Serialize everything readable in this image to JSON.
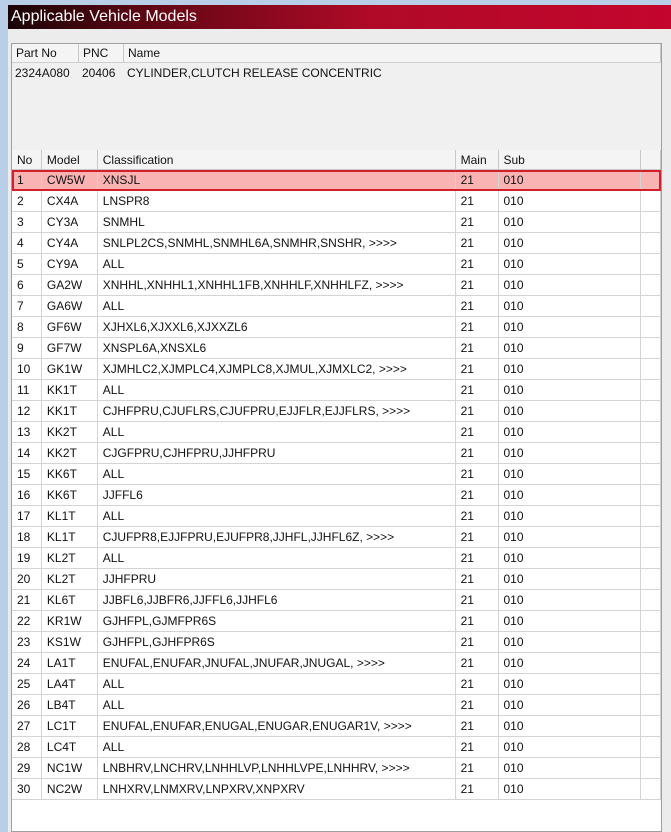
{
  "title": "Applicable Vehicle Models",
  "part": {
    "headers": [
      "Part No",
      "PNC",
      "Name"
    ],
    "part_no": "2324A080",
    "pnc": "20406",
    "name": "CYLINDER,CLUTCH RELEASE CONCENTRIC"
  },
  "table": {
    "headers": [
      "No",
      "Model",
      "Classification",
      "Main",
      "Sub"
    ],
    "rows": [
      [
        "1",
        "CW5W",
        "XNSJL",
        "21",
        "010"
      ],
      [
        "2",
        "CX4A",
        "LNSPR8",
        "21",
        "010"
      ],
      [
        "3",
        "CY3A",
        "SNMHL",
        "21",
        "010"
      ],
      [
        "4",
        "CY4A",
        "SNLPL2CS,SNMHL,SNMHL6A,SNMHR,SNSHR,  >>>>",
        "21",
        "010"
      ],
      [
        "5",
        "CY9A",
        "ALL",
        "21",
        "010"
      ],
      [
        "6",
        "GA2W",
        "XNHHL,XNHHL1,XNHHL1FB,XNHHLF,XNHHLFZ,  >>>>",
        "21",
        "010"
      ],
      [
        "7",
        "GA6W",
        "ALL",
        "21",
        "010"
      ],
      [
        "8",
        "GF6W",
        "XJHXL6,XJXXL6,XJXXZL6",
        "21",
        "010"
      ],
      [
        "9",
        "GF7W",
        "XNSPL6A,XNSXL6",
        "21",
        "010"
      ],
      [
        "10",
        "GK1W",
        "XJMHLC2,XJMPLC4,XJMPLC8,XJMUL,XJMXLC2,  >>>>",
        "21",
        "010"
      ],
      [
        "11",
        "KK1T",
        "ALL",
        "21",
        "010"
      ],
      [
        "12",
        "KK1T",
        "CJHFPRU,CJUFLRS,CJUFPRU,EJJFLR,EJJFLRS,  >>>>",
        "21",
        "010"
      ],
      [
        "13",
        "KK2T",
        "ALL",
        "21",
        "010"
      ],
      [
        "14",
        "KK2T",
        "CJGFPRU,CJHFPRU,JJHFPRU",
        "21",
        "010"
      ],
      [
        "15",
        "KK6T",
        "ALL",
        "21",
        "010"
      ],
      [
        "16",
        "KK6T",
        "JJFFL6",
        "21",
        "010"
      ],
      [
        "17",
        "KL1T",
        "ALL",
        "21",
        "010"
      ],
      [
        "18",
        "KL1T",
        "CJUFPR8,EJJFPRU,EJUFPR8,JJHFL,JJHFL6Z,  >>>>",
        "21",
        "010"
      ],
      [
        "19",
        "KL2T",
        "ALL",
        "21",
        "010"
      ],
      [
        "20",
        "KL2T",
        "JJHFPRU",
        "21",
        "010"
      ],
      [
        "21",
        "KL6T",
        "JJBFL6,JJBFR6,JJFFL6,JJHFL6",
        "21",
        "010"
      ],
      [
        "22",
        "KR1W",
        "GJHFPL,GJMFPR6S",
        "21",
        "010"
      ],
      [
        "23",
        "KS1W",
        "GJHFPL,GJHFPR6S",
        "21",
        "010"
      ],
      [
        "24",
        "LA1T",
        "ENUFAL,ENUFAR,JNUFAL,JNUFAR,JNUGAL,  >>>>",
        "21",
        "010"
      ],
      [
        "25",
        "LA4T",
        "ALL",
        "21",
        "010"
      ],
      [
        "26",
        "LB4T",
        "ALL",
        "21",
        "010"
      ],
      [
        "27",
        "LC1T",
        "ENUFAL,ENUFAR,ENUGAL,ENUGAR,ENUGAR1V,  >>>>",
        "21",
        "010"
      ],
      [
        "28",
        "LC4T",
        "ALL",
        "21",
        "010"
      ],
      [
        "29",
        "NC1W",
        "LNBHRV,LNCHRV,LNHHLVP,LNHHLVPE,LNHHRV,  >>>>",
        "21",
        "010"
      ],
      [
        "30",
        "NC2W",
        "LNHXRV,LNMXRV,LNPXRV,XNPXRV",
        "21",
        "010"
      ]
    ]
  }
}
